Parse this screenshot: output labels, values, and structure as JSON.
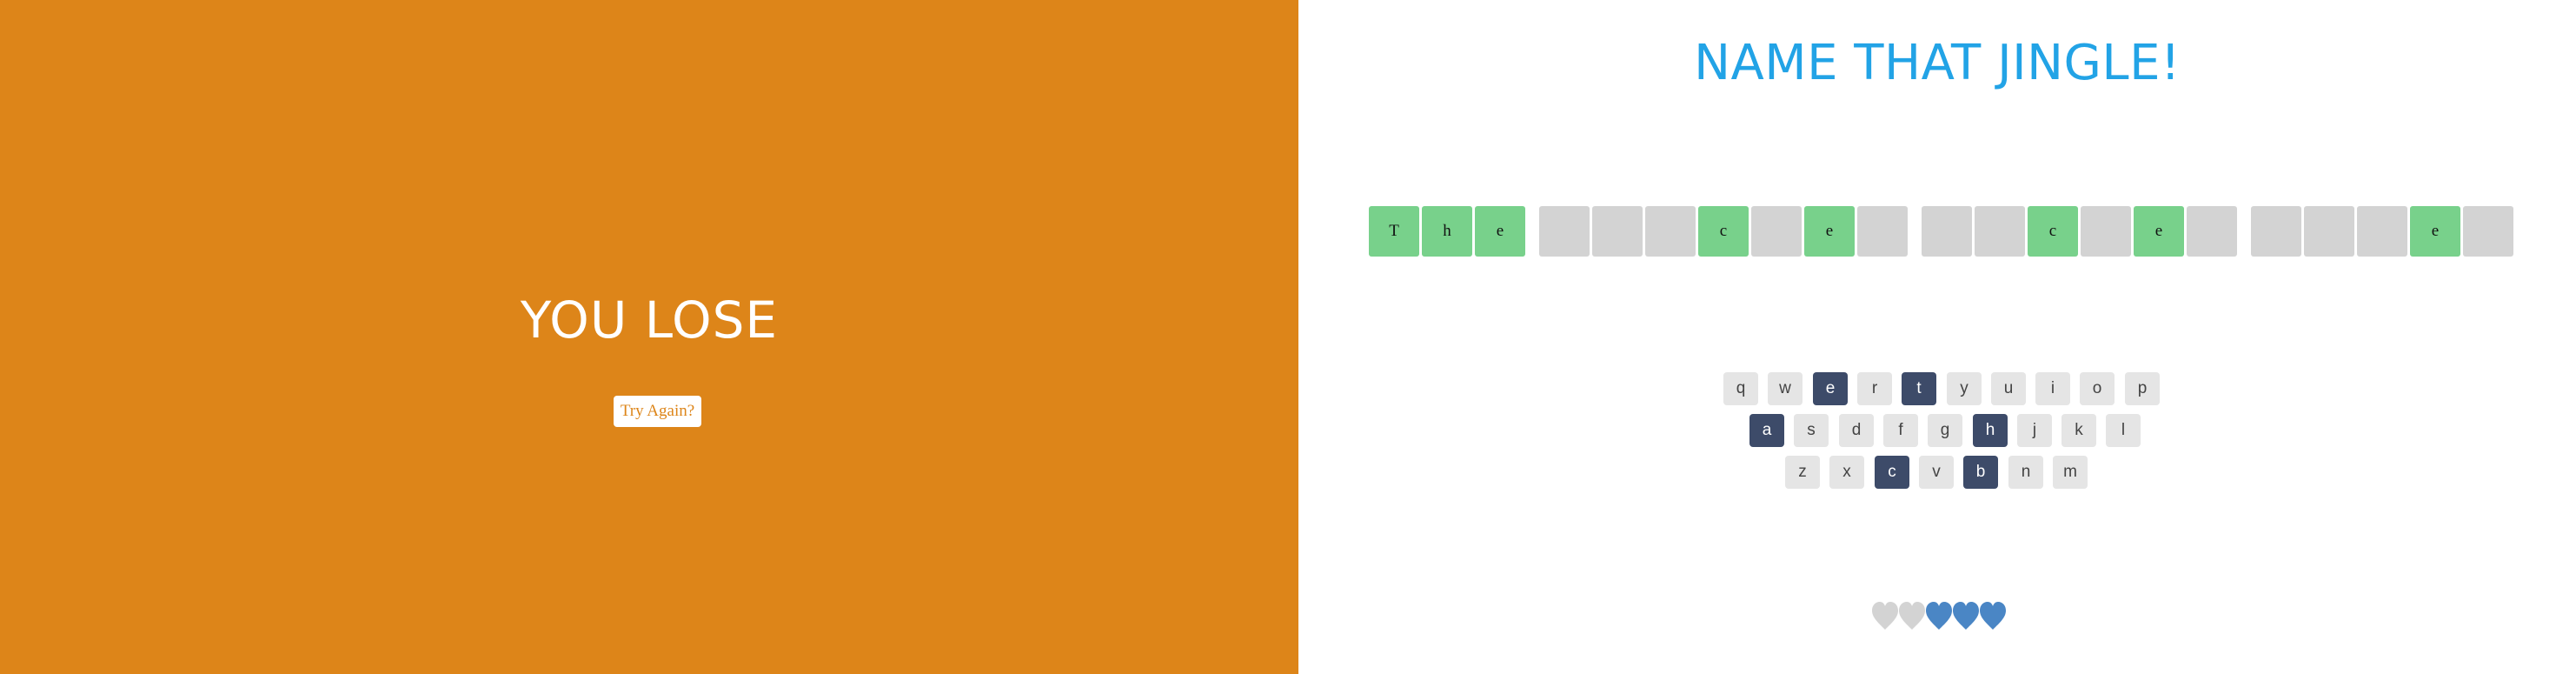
{
  "lose": {
    "title": "YOU LOSE",
    "button_label": "Try Again?"
  },
  "game": {
    "title": "NAME THAT JINGLE!"
  },
  "puzzle": {
    "words": [
      [
        "T",
        "h",
        "e"
      ],
      [
        "",
        "",
        "",
        "c",
        "",
        "e",
        ""
      ],
      [
        "",
        "",
        "c",
        "",
        "e",
        ""
      ],
      [
        "",
        "",
        "",
        "e",
        ""
      ]
    ]
  },
  "keyboard": {
    "rows": [
      [
        "q",
        "w",
        "e",
        "r",
        "t",
        "y",
        "u",
        "i",
        "o",
        "p"
      ],
      [
        "a",
        "s",
        "d",
        "f",
        "g",
        "h",
        "j",
        "k",
        "l"
      ],
      [
        "z",
        "x",
        "c",
        "v",
        "b",
        "n",
        "m"
      ]
    ],
    "used": [
      "e",
      "t",
      "a",
      "h",
      "c",
      "b"
    ]
  },
  "lives": {
    "total": 5,
    "lost": 2,
    "remaining": 3
  },
  "colors": {
    "lose_background": "#dd8519",
    "title_blue": "#22a3e6",
    "revealed_tile": "#78d18b",
    "empty_tile": "#d3d3d3",
    "used_key": "#3d4b69",
    "unused_key": "#e5e5e5",
    "heart_full": "#4a86c5",
    "heart_lost": "#d3d3d3"
  }
}
